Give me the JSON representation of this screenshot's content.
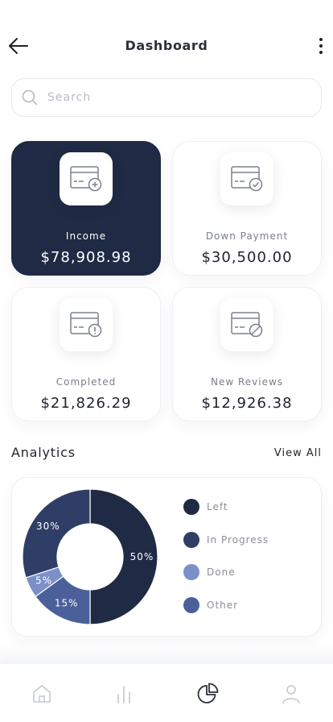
{
  "header": {
    "title": "Dashboard",
    "back_icon": "arrow-left-icon",
    "more_icon": "more-vertical-icon"
  },
  "search": {
    "placeholder": "Search",
    "value": "",
    "icon": "search-icon"
  },
  "cards": [
    {
      "label": "Income",
      "value": "$78,908.98",
      "icon": "card-add-icon",
      "active": true
    },
    {
      "label": "Down Payment",
      "value": "$30,500.00",
      "icon": "card-check-icon",
      "active": false
    },
    {
      "label": "Completed",
      "value": "$21,826.29",
      "icon": "card-alert-icon",
      "active": false
    },
    {
      "label": "New Reviews",
      "value": "$12,926.38",
      "icon": "card-block-icon",
      "active": false
    }
  ],
  "analytics": {
    "title": "Analytics",
    "view_all": "View All"
  },
  "chart_data": {
    "type": "pie",
    "donut": true,
    "categories": [
      "Left",
      "In Progress",
      "Done",
      "Other"
    ],
    "series": [
      {
        "values": [
          50,
          30,
          5,
          15
        ]
      }
    ],
    "slice_labels": [
      "50%",
      "30%",
      "5%",
      "15%"
    ],
    "colors": [
      "#1f2a44",
      "#2f3e66",
      "#7b90c8",
      "#4b5f9a"
    ],
    "legend_colors": [
      "#1f2a44",
      "#2f3e66",
      "#7b90c8",
      "#4b5f9a"
    ],
    "legend_placement": "right"
  },
  "colors": {
    "primary_dark": "#1f2a44",
    "accent_blue": "#4b5f9a",
    "light_blue": "#7b90c8",
    "text_muted": "#7a7f88"
  },
  "bottom_nav": {
    "items": [
      {
        "icon": "home-icon",
        "active": false
      },
      {
        "icon": "bar-chart-icon",
        "active": false
      },
      {
        "icon": "pie-chart-icon",
        "active": true
      },
      {
        "icon": "user-icon",
        "active": false
      }
    ]
  }
}
